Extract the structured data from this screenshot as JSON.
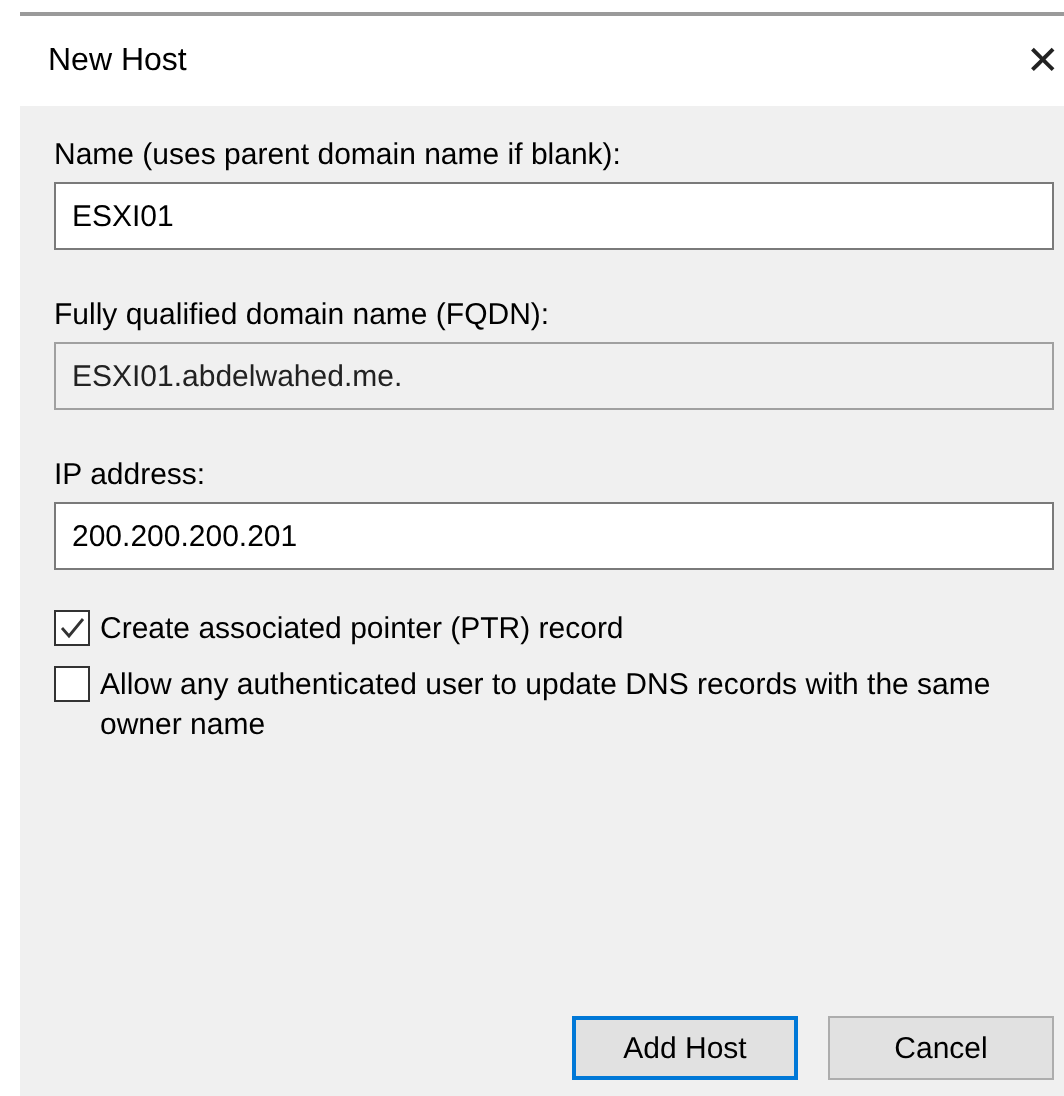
{
  "window": {
    "title": "New Host",
    "close": "✕"
  },
  "fields": [
    {
      "label": "Name (uses parent domain name if blank):",
      "value": "ESXI01",
      "disabled": false
    },
    {
      "label": "Fully qualified domain name (FQDN):",
      "value": "ESXI01.abdelwahed.me.",
      "disabled": true
    },
    {
      "label": "IP address:",
      "value": "200.200.200.201",
      "disabled": false
    }
  ],
  "options": [
    {
      "label": "Create associated pointer (PTR) record",
      "checked": true
    },
    {
      "label": "Allow any authenticated user to update DNS records with the same owner name",
      "checked": false
    }
  ],
  "buttons": [
    {
      "label": "Add Host",
      "default": true
    },
    {
      "label": "Cancel",
      "default": false
    }
  ]
}
